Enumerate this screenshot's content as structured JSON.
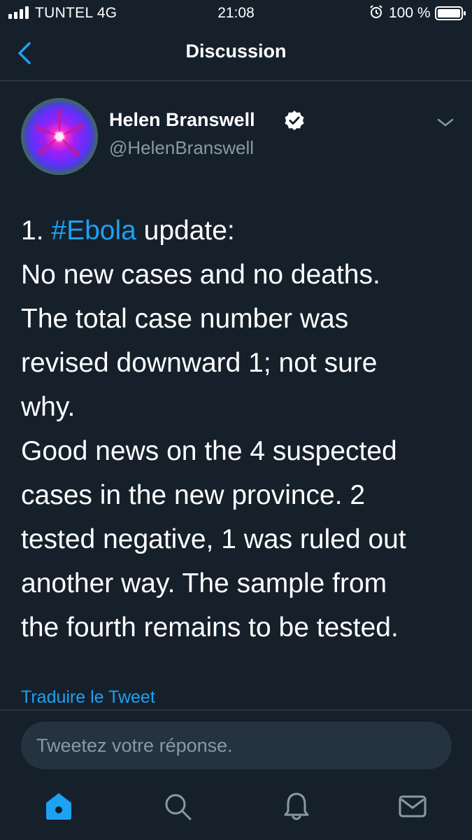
{
  "status_bar": {
    "carrier": "TUNTEL 4G",
    "time": "21:08",
    "battery": "100 %"
  },
  "nav": {
    "title": "Discussion",
    "back_icon": "chevron-left-icon"
  },
  "tweet": {
    "author_name": "Helen Branswell",
    "author_handle": "@HelenBranswell",
    "verified": true,
    "text_line_1_prefix": "1. ",
    "hashtag": "#Ebola",
    "text_line_1_suffix": " update:",
    "lines": [
      "No new cases and no deaths.",
      "The total case number was",
      "revised downward 1; not sure",
      "why.",
      "Good news on the 4 suspected",
      "cases in the new province. 2",
      "tested negative, 1 was ruled out",
      "another way. The sample from",
      "the fourth remains to be tested."
    ],
    "translate_label": "Traduire le Tweet"
  },
  "reply": {
    "placeholder": "Tweetez votre réponse."
  },
  "tab_bar": {
    "tabs": [
      "home-icon",
      "search-icon",
      "notifications-icon",
      "messages-icon"
    ],
    "active": "home-icon"
  },
  "colors": {
    "background": "#15202b",
    "accent": "#1da1f2",
    "secondary_text": "#8899a6",
    "divider": "#38444d",
    "input_bg": "#253341"
  }
}
